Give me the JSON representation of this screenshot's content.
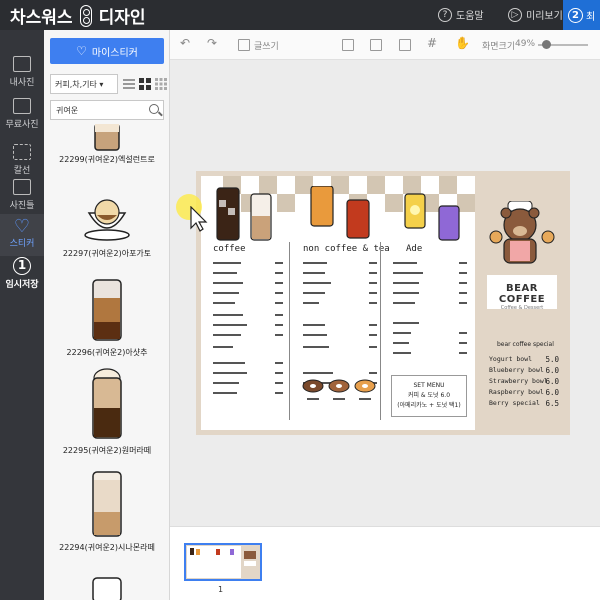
{
  "header": {
    "logo_left": "차스워스",
    "logo_right": "디자인",
    "help_label": "도움말",
    "preview_label": "미리보기",
    "step_number": "2",
    "step_label": "최"
  },
  "rail": [
    {
      "name": "my-photos",
      "label": "내사진"
    },
    {
      "name": "free-photos",
      "label": "무료사진"
    },
    {
      "name": "frame",
      "label": "칼선"
    },
    {
      "name": "photo-frame",
      "label": "사진틀"
    },
    {
      "name": "sticker",
      "label": "스티커"
    },
    {
      "name": "temp-save",
      "label": "임시저장",
      "number": "1"
    }
  ],
  "panel": {
    "my_sticker_label": "마이스티커",
    "category_value": "커피,차,기타 ▾",
    "search_value": "귀여운",
    "stickers": [
      {
        "label": "22299(귀여운2)엑설런트로"
      },
      {
        "label": "22297(귀여운2)아포가토"
      },
      {
        "label": "22296(귀여운2)아샷추"
      },
      {
        "label": "22295(귀여운2)원머라떼"
      },
      {
        "label": "22294(귀여운2)시나몬라떼"
      }
    ]
  },
  "toolbar": {
    "text_label": "글쓰기",
    "zoom_label": "화면크기",
    "zoom_value": "49%"
  },
  "design": {
    "col1_title": "coffee",
    "col2_title": "non coffee & tea",
    "col3_title": "Ade",
    "set_menu_title": "SET MENU",
    "set_menu_line1": "커피 & 도넛 6.0",
    "set_menu_line2": "(아메리카노 + 도넛 택1)",
    "logo_title": "BEAR COFFEE",
    "logo_sub": "Coffee & Dessert",
    "special_title": "bear coffee special",
    "special_items": [
      {
        "name": "Yogurt bowl",
        "price": "5.0"
      },
      {
        "name": "Blueberry bowl",
        "price": "6.0"
      },
      {
        "name": "Strawberry bowl",
        "price": "6.0"
      },
      {
        "name": "Raspberry bowl",
        "price": "6.0"
      },
      {
        "name": "Berry special",
        "price": "6.5"
      }
    ],
    "colors": {
      "checker": "#cfc2b0",
      "background": "#e2d6c7"
    }
  },
  "thumbs": {
    "page_number": "1"
  }
}
